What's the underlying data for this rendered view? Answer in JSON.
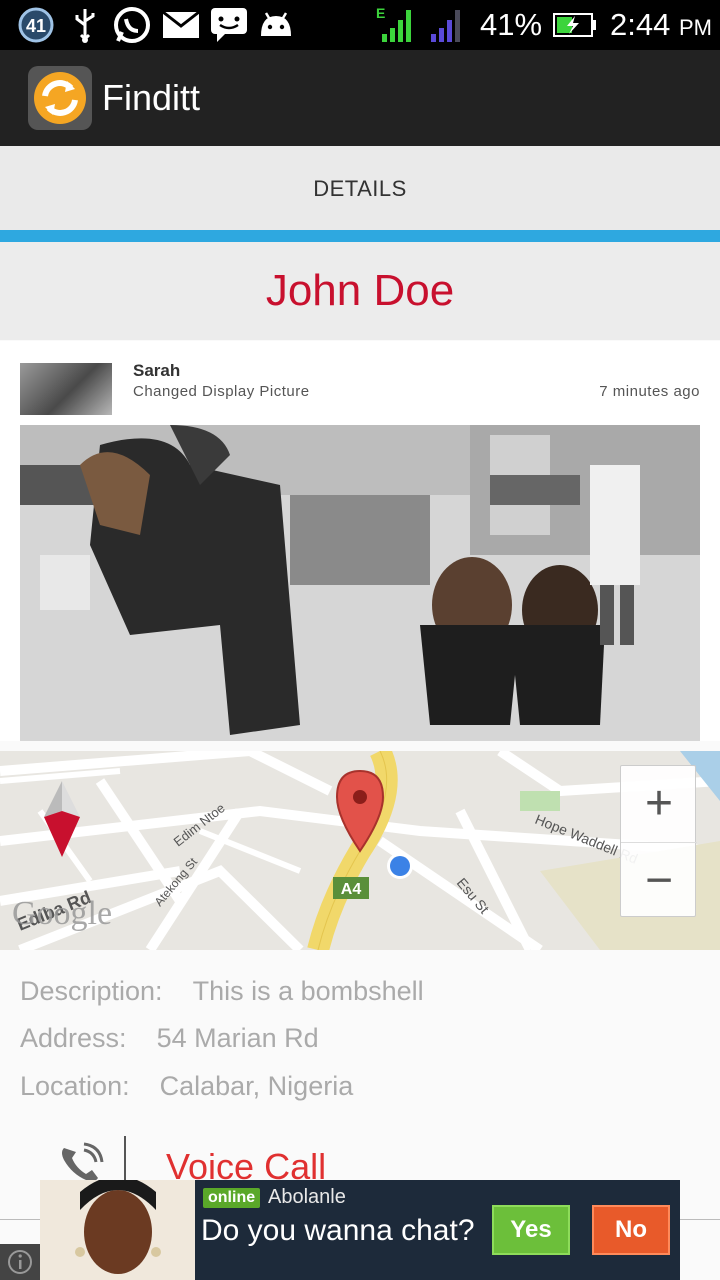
{
  "status_bar": {
    "notification_count": "41",
    "network_type": "E",
    "battery": "41%",
    "time": "2:44",
    "ampm": "PM",
    "icons": [
      "notification-badge-icon",
      "usb-icon",
      "whatsapp-icon",
      "mail-icon",
      "sms-icon",
      "android-icon",
      "signal-icon",
      "signal-icon",
      "battery-charging-icon"
    ]
  },
  "app_bar": {
    "title": "Finditt",
    "logo_icon": "finditt-logo-icon",
    "logo_color": "#f5a623"
  },
  "tabs": [
    {
      "label": "DETAILS",
      "selected": true
    }
  ],
  "accent_color": "#2ea8e0",
  "person": {
    "name": "John Doe",
    "name_color": "#c8102e"
  },
  "feed": {
    "user": "Sarah",
    "action": "Changed Display Picture",
    "time": "7 minutes ago"
  },
  "map": {
    "streets": [
      "Ediba Rd",
      "Edim Ntoe",
      "Atekong St",
      "Esu St",
      "Hope Waddell Rd"
    ],
    "route_badge": "A4",
    "zoom_in": "+",
    "zoom_out": "−",
    "logo": "Google"
  },
  "details": {
    "description_label": "Description:",
    "description": "This is a bombshell",
    "address_label": "Address:",
    "address": "54 Marian Rd",
    "location_label": "Location:",
    "location": "Calabar, Nigeria"
  },
  "actions": {
    "voice_call": "Voice Call",
    "voice_call_icon": "phone-call-icon"
  },
  "ad": {
    "status": "online",
    "user": "Abolanle",
    "question": "Do you wanna chat?",
    "yes": "Yes",
    "no": "No"
  }
}
